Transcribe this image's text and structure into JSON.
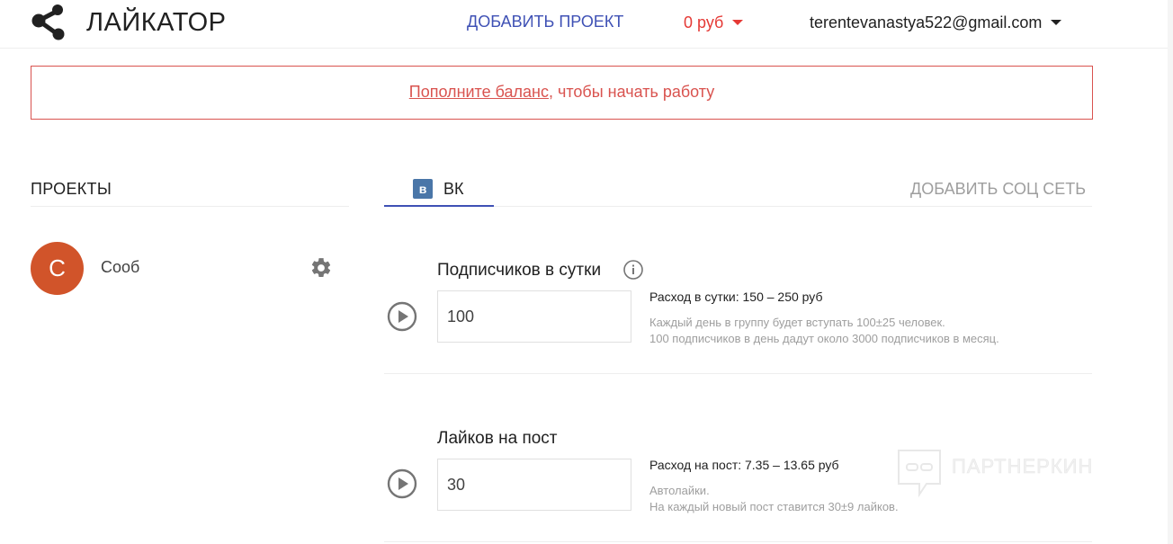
{
  "header": {
    "brand": "ЛАЙКАТОР",
    "add_project": "ДОБАВИТЬ ПРОЕКТ",
    "balance": "0 руб",
    "user_email": "terentevanastya522@gmail.com",
    "accent": "#3f51b5",
    "balance_color": "#e53935"
  },
  "alert": {
    "link_text": "Пополните баланс",
    "rest_text": ", чтобы начать работу"
  },
  "projects": {
    "title": "ПРОЕКТЫ",
    "items": [
      {
        "avatar_letter": "C",
        "name": "Сооб",
        "avatar_color": "#d1542a"
      }
    ]
  },
  "tabs": {
    "active": {
      "icon": "в",
      "label": "ВК"
    },
    "add_social": "ДОБАВИТЬ СОЦ СЕТЬ"
  },
  "settings": [
    {
      "title": "Подписчиков в сутки",
      "value": "100",
      "cost": "Расход в сутки: 150 – 250 руб",
      "desc_line1": "Каждый день в группу будет вступать 100±25 человек.",
      "desc_line2": "100 подписчиков в день дадут около 3000 подписчиков в месяц."
    },
    {
      "title": "Лайков на пост",
      "value": "30",
      "cost": "Расход на пост: 7.35 – 13.65 руб",
      "desc_line1": "Автолайки.",
      "desc_line2": "На каждый новый пост ставится 30±9 лайков."
    }
  ],
  "watermark": {
    "text": "ПАРТНЕРКИН"
  }
}
